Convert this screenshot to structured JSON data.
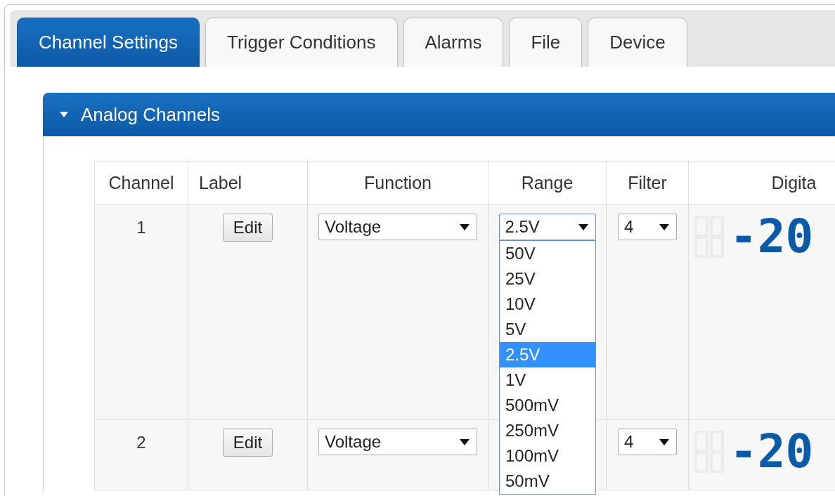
{
  "tabs": [
    {
      "label": "Channel Settings",
      "selected": true
    },
    {
      "label": "Trigger Conditions",
      "selected": false
    },
    {
      "label": "Alarms",
      "selected": false
    },
    {
      "label": "File",
      "selected": false
    },
    {
      "label": "Device",
      "selected": false
    }
  ],
  "panel": {
    "title": "Analog Channels",
    "expanded": true
  },
  "table": {
    "columns": [
      "Channel",
      "Label",
      "Function",
      "Range",
      "Filter",
      "Digita"
    ],
    "rows": [
      {
        "channel": "1",
        "label_button": "Edit",
        "function": "Voltage",
        "range": "2.5V",
        "range_open": true,
        "filter": "4",
        "reading": "-20"
      },
      {
        "channel": "2",
        "label_button": "Edit",
        "function": "Voltage",
        "range_open": false,
        "filter": "4",
        "reading": "-20"
      }
    ]
  },
  "range_options": [
    {
      "label": "50V",
      "selected": false
    },
    {
      "label": "25V",
      "selected": false
    },
    {
      "label": "10V",
      "selected": false
    },
    {
      "label": "5V",
      "selected": false
    },
    {
      "label": "2.5V",
      "selected": true
    },
    {
      "label": "1V",
      "selected": false
    },
    {
      "label": "500mV",
      "selected": false
    },
    {
      "label": "250mV",
      "selected": false
    },
    {
      "label": "100mV",
      "selected": false
    },
    {
      "label": "50mV",
      "selected": false
    }
  ]
}
